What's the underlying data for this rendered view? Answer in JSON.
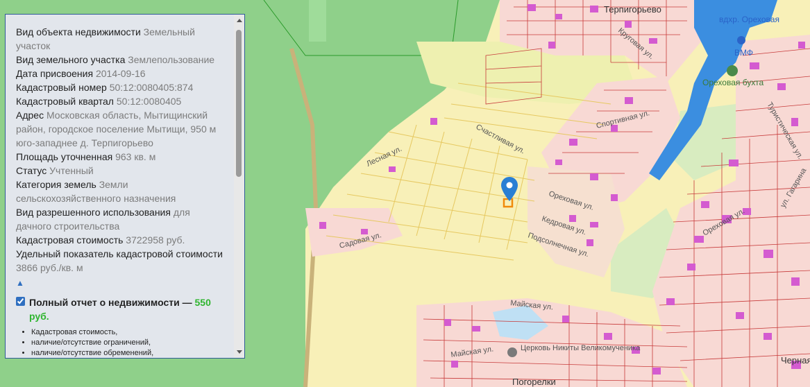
{
  "panel": {
    "rows": [
      {
        "label": "Вид объекта недвижимости",
        "value": "Земельный участок"
      },
      {
        "label": "Вид земельного участка",
        "value": "Землепользование"
      },
      {
        "label": "Дата присвоения",
        "value": "2014-09-16"
      },
      {
        "label": "Кадастровый номер",
        "value": "50:12:0080405:874"
      },
      {
        "label": "Кадастровый квартал",
        "value": "50:12:0080405"
      },
      {
        "label": "Адрес",
        "value": "Московская область, Мытищинский район, городское поселение Мытищи, 950 м юго-западнее д. Терпигорьево"
      },
      {
        "label": "Площадь уточненная",
        "value": "963 кв. м"
      },
      {
        "label": "Статус",
        "value": "Учтенный"
      },
      {
        "label": "Категория земель",
        "value": "Земли сельскохозяйственного назначения"
      },
      {
        "label": "Вид разрешенного использования",
        "value": "для дачного строительства"
      },
      {
        "label": "Кадастровая стоимость",
        "value": "3722958 руб."
      },
      {
        "label": "Удельный показатель кадастровой стоимости",
        "value": "3866 руб./кв. м"
      }
    ],
    "collapse_glyph": "▲",
    "report": {
      "checked": true,
      "title": "Полный отчет о недвижимости —",
      "price": "550 руб.",
      "items": [
        "Кадастровая стоимость,",
        "наличие/отсутствие ограничений,",
        "наличие/отсутствие обременений,"
      ]
    }
  },
  "map": {
    "places": {
      "terpigorevo": "Терпигорьево",
      "pogorelki": "Погорелки",
      "chernaya": "Черная"
    },
    "water": "вдхр. Ореховая",
    "pois": {
      "vmf": "ВМФ",
      "orekhovaya_bukhta": "Ореховая бухта",
      "church": "Церковь Никиты Великомученика"
    },
    "streets": [
      "Лесная ул.",
      "Садовая ул.",
      "Счастливая ул.",
      "Ореховая ул.",
      "Кедровая ул.",
      "Подсолнечная ул.",
      "Майская ул.",
      "Майская ул.",
      "Спортивная ул.",
      "Туристическая ул.",
      "Круговая ул.",
      "Ореховая ул.",
      "ул. Гагарина"
    ],
    "colors": {
      "forest": "#8fd08a",
      "settlement": "#f8d9d4",
      "field": "#f8f0b8",
      "water": "#3b8ee0",
      "parcel_line": "#c73a3a",
      "building": "#d45bd0",
      "marker": "#2a7fd4",
      "parcel_highlight": "#f08a0a"
    }
  }
}
